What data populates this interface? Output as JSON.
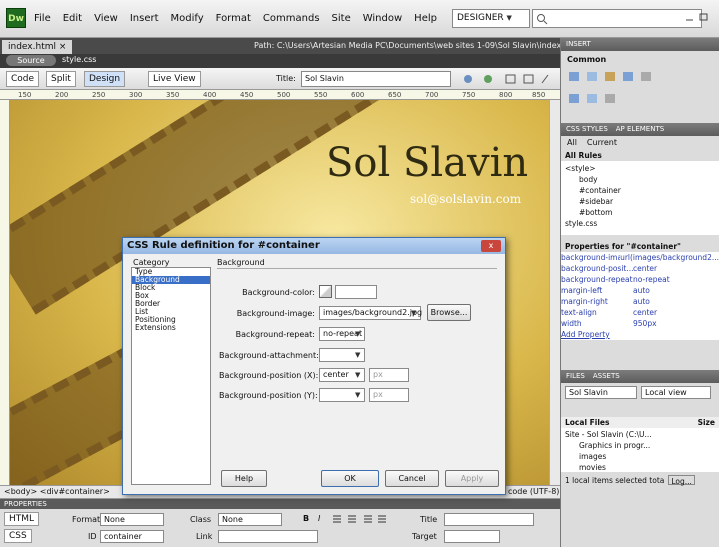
{
  "app": {
    "logo": "Dw",
    "menu": [
      "File",
      "Edit",
      "View",
      "Insert",
      "Modify",
      "Format",
      "Commands",
      "Site",
      "Window",
      "Help"
    ],
    "workspace": "DESIGNER",
    "workspace_caret": "▼"
  },
  "doc": {
    "tab": "index.html ×",
    "path": "Path: C:\\Users\\Artesian Media PC\\Documents\\web sites 1-09\\Sol Slavin\\index.html",
    "source_code": "Source Code",
    "related_file": "style.css"
  },
  "doc_toolbar": {
    "code": "Code",
    "split": "Split",
    "design": "Design",
    "live_view": "Live View",
    "title_label": "Title:",
    "title_value": "Sol Slavin"
  },
  "ruler_marks": [
    "150",
    "200",
    "250",
    "300",
    "350",
    "400",
    "450",
    "500",
    "550",
    "600",
    "650",
    "700",
    "750",
    "800",
    "850"
  ],
  "canvas": {
    "site_name": "Sol Slavin",
    "site_email": "sol@solslavin.com"
  },
  "tag_selector": "<body> <div#container>",
  "encoding": "code (UTF-8)",
  "properties": {
    "header": "PROPERTIES",
    "html_btn": "HTML",
    "css_btn": "CSS",
    "format_label": "Format",
    "format_value": "None",
    "class_label": "Class",
    "class_value": "None",
    "id_label": "ID",
    "id_value": "container",
    "link_label": "Link",
    "title_label": "Title",
    "target_label": "Target",
    "bold": "B",
    "italic": "I"
  },
  "panels": {
    "insert_header": "INSERT",
    "common": "Common",
    "css_styles_tab": "CSS STYLES",
    "ap_elements_tab": "AP ELEMENTS",
    "all": "All",
    "current": "Current",
    "all_rules": "All Rules",
    "rules": [
      "<style>",
      "body",
      "#container",
      "#sidebar",
      "#bottom",
      "style.css"
    ],
    "props_header": "Properties for \"#container\"",
    "props": [
      {
        "k": "background-image",
        "v": "url(images/background2..."
      },
      {
        "k": "background-posit...",
        "v": "center"
      },
      {
        "k": "background-repeat",
        "v": "no-repeat"
      },
      {
        "k": "margin-left",
        "v": "auto"
      },
      {
        "k": "margin-right",
        "v": "auto"
      },
      {
        "k": "text-align",
        "v": "center"
      },
      {
        "k": "width",
        "v": "950px"
      }
    ],
    "add_property": "Add Property",
    "files_tab": "FILES",
    "assets_tab": "ASSETS",
    "site": "Sol Slavin",
    "view": "Local view",
    "local_files": "Local Files",
    "size": "Size",
    "files": [
      "Site - Sol Slavin (C:\\U...",
      "Graphics in progr...",
      "images",
      "movies"
    ],
    "status": "1 local items selected tota",
    "log": "Log..."
  },
  "dialog": {
    "title": "CSS Rule definition for #container",
    "close": "x",
    "category_label": "Category",
    "section_label": "Background",
    "categories": [
      "Type",
      "Background",
      "Block",
      "Box",
      "Border",
      "List",
      "Positioning",
      "Extensions"
    ],
    "fields": {
      "bg_color_label": "Background-color:",
      "bg_image_label": "Background-image:",
      "bg_image_value": "images/background2.jpg",
      "browse": "Browse...",
      "bg_repeat_label": "Background-repeat:",
      "bg_repeat_value": "no-repeat",
      "bg_attach_label": "Background-attachment:",
      "bg_attach_value": "",
      "bg_posx_label": "Background-position (X):",
      "bg_posx_value": "center",
      "bg_posx_unit": "px",
      "bg_posy_label": "Background-position (Y):",
      "bg_posy_value": "",
      "bg_posy_unit": "px"
    },
    "help": "Help",
    "ok": "OK",
    "cancel": "Cancel",
    "apply": "Apply",
    "caret": "▼"
  }
}
